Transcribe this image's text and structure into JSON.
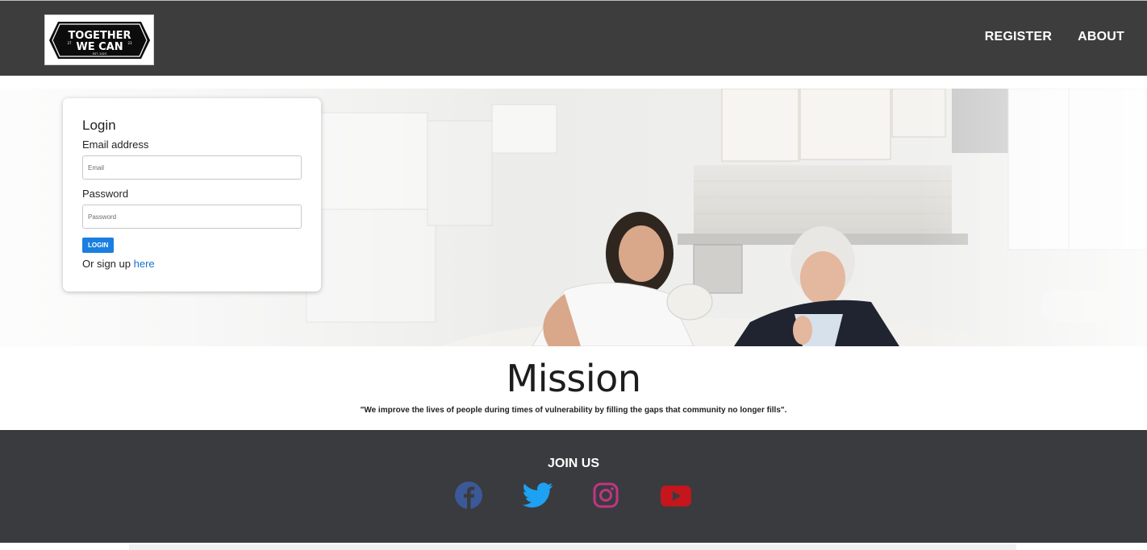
{
  "header": {
    "logo": {
      "line1": "TOGETHER",
      "line2": "WE CAN",
      "small_left": "27",
      "small_right": "23",
      "est": "EST. 2023"
    },
    "nav": [
      {
        "label": "REGISTER"
      },
      {
        "label": "ABOUT"
      }
    ]
  },
  "login": {
    "title": "Login",
    "email_label": "Email address",
    "email_placeholder": "Email",
    "password_label": "Password",
    "password_placeholder": "Password",
    "button_label": "LOGIN",
    "signup_text": "Or sign up",
    "signup_link": "here"
  },
  "mission": {
    "title": "Mission",
    "quote": "\"We improve the lives of people during times of vulnerability by filling the gaps that community no longer fills\"."
  },
  "footer": {
    "join_title": "JOIN US",
    "socials": [
      {
        "icon": "facebook-icon",
        "color": "#3b5998"
      },
      {
        "icon": "twitter-icon",
        "color": "#1da1f2"
      },
      {
        "icon": "instagram-icon",
        "color": "#c13584"
      },
      {
        "icon": "youtube-icon",
        "color": "#c4161c"
      }
    ]
  },
  "colors": {
    "navbar": "#3d3d3d",
    "footer": "#3a3b3f",
    "accent": "#1a7fe0"
  }
}
